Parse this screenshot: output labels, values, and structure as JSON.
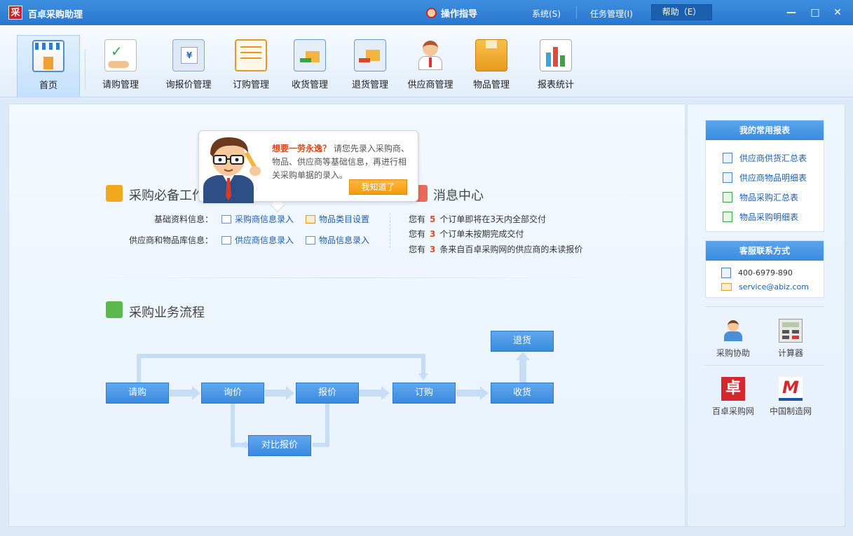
{
  "titlebar": {
    "logo_char": "采",
    "title": "百卓采购助理",
    "guide": "操作指导",
    "menu_system": "系统(S)",
    "menu_tasks": "任务管理(I)",
    "menu_help": "帮助（E）",
    "minimize": "—",
    "maximize": "□",
    "close": "✕"
  },
  "toolbar": {
    "items": [
      {
        "label": "首页",
        "icon": "store-icon"
      },
      {
        "label": "请购管理",
        "icon": "request-icon"
      },
      {
        "label": "询报价管理",
        "icon": "quote-icon"
      },
      {
        "label": "订购管理",
        "icon": "order-icon"
      },
      {
        "label": "收货管理",
        "icon": "receive-icon"
      },
      {
        "label": "退货管理",
        "icon": "return-icon"
      },
      {
        "label": "供应商管理",
        "icon": "supplier-icon"
      },
      {
        "label": "物品管理",
        "icon": "goods-icon"
      },
      {
        "label": "报表统计",
        "icon": "report-icon"
      }
    ]
  },
  "tooltip": {
    "highlight": "想要一劳永逸？",
    "text": "请您先录入采购商、物品、供应商等基础信息，再进行相关采购单据的录入。",
    "button": "我知道了"
  },
  "essential": {
    "title": "采购必备工作",
    "row1_label": "基础资料信息：",
    "row1_link1": "采购商信息录入",
    "row1_link2": "物品类目设置",
    "row2_label": "供应商和物品库信息：",
    "row2_link1": "供应商信息录入",
    "row2_link2": "物品信息录入"
  },
  "messages": {
    "title": "消息中心",
    "items": [
      {
        "prefix": "您有",
        "count": "5",
        "suffix": "个订单即将在3天内全部交付"
      },
      {
        "prefix": "您有",
        "count": "3",
        "suffix": "个订单未按期完成交付"
      },
      {
        "prefix": "您有",
        "count": "3",
        "suffix": "条来自百卓采购网的供应商的未读报价"
      }
    ]
  },
  "flow": {
    "title": "采购业务流程",
    "request": "请购",
    "inquiry": "询价",
    "quote": "报价",
    "order": "订购",
    "receive": "收货",
    "return": "退货",
    "compare": "对比报价"
  },
  "right": {
    "reports_title": "我的常用报表",
    "reports": [
      "供应商供货汇总表",
      "供应商物品明细表",
      "物品采购汇总表",
      "物品采购明细表"
    ],
    "contact_title": "客服联系方式",
    "phone": "400-6979-890",
    "email": "service@abiz.com",
    "tool1": "采购协助",
    "tool2": "计算器",
    "site1": "百卓采购网",
    "site2": "中国制造网",
    "site1_logo": "卓",
    "site2_logo": "M"
  }
}
